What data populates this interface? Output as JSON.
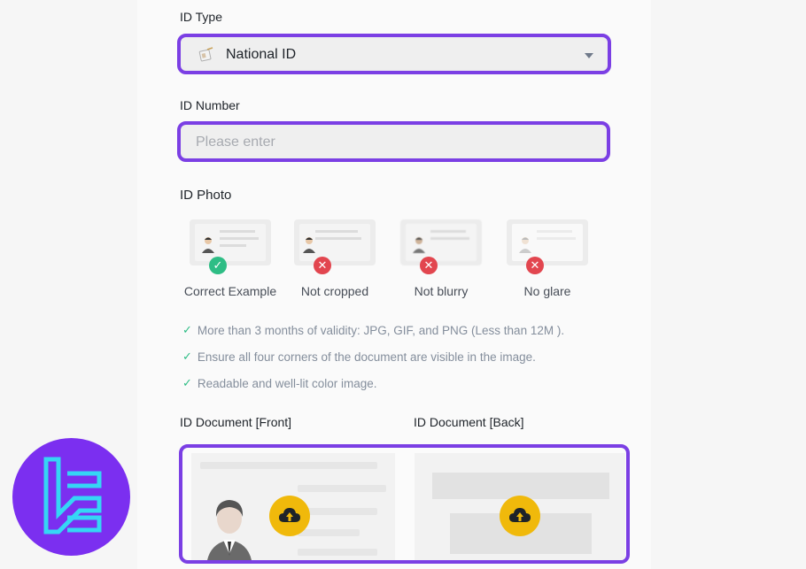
{
  "form": {
    "id_type": {
      "label": "ID Type",
      "selected": "National ID"
    },
    "id_number": {
      "label": "ID Number",
      "placeholder": "Please enter",
      "value": ""
    },
    "id_photo": {
      "label": "ID Photo",
      "examples": [
        {
          "caption": "Correct Example",
          "status": "ok"
        },
        {
          "caption": "Not cropped",
          "status": "bad"
        },
        {
          "caption": "Not blurry",
          "status": "bad"
        },
        {
          "caption": "No glare",
          "status": "bad"
        }
      ]
    },
    "requirements": [
      "More than 3 months of validity: JPG, GIF, and PNG (Less than 12M ).",
      "Ensure all four corners of the document are visible in the image.",
      "Readable and well-lit color image."
    ],
    "upload": {
      "front_label": "ID Document [Front]",
      "back_label": "ID Document [Back]"
    }
  },
  "colors": {
    "accent": "#7b3fe4",
    "upload": "#f0b90b",
    "ok": "#2ebd85",
    "bad": "#e2464f",
    "logo_bg": "#7b2ff0",
    "logo_fg": "#35d6f5"
  },
  "icons": {
    "id_type": "id-card-icon",
    "dropdown": "chevron-down-icon",
    "upload": "cloud-upload-icon",
    "check": "check-icon"
  }
}
